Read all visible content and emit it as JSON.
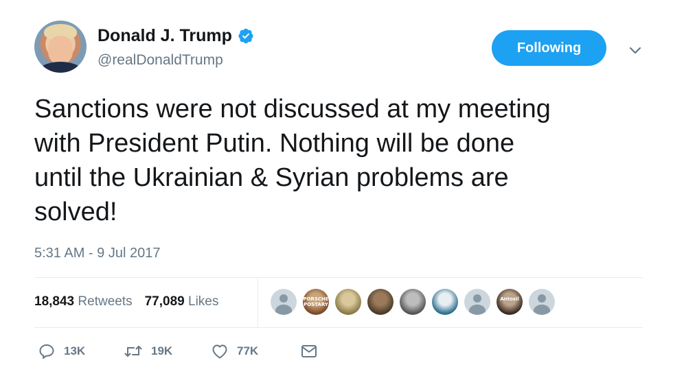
{
  "author": {
    "name": "Donald J. Trump",
    "handle": "@realDonaldTrump",
    "verified_icon": "verified-badge-icon"
  },
  "follow_button": {
    "label": "Following",
    "color": "#1da1f2"
  },
  "menu_icon": "chevron-down-icon",
  "tweet": {
    "line1": "Sanctions were not discussed at my meeting",
    "line2": "with President Putin. Nothing will be done",
    "line3": "until the Ukrainian & Syrian problems are",
    "line4": "solved!",
    "timestamp": "5:31 AM - 9 Jul 2017"
  },
  "stats": {
    "retweets_count": "18,843",
    "retweets_label": "Retweets",
    "likes_count": "77,089",
    "likes_label": "Likes"
  },
  "likers": [
    {
      "kind": "default"
    },
    {
      "kind": "image",
      "colors": [
        "#7b4a2a",
        "#c9a47a"
      ],
      "text": "PORSCHE POSTARY"
    },
    {
      "kind": "image",
      "colors": [
        "#8b7a4a",
        "#d8c89a"
      ]
    },
    {
      "kind": "image",
      "colors": [
        "#4a3a2a",
        "#9a7a5a"
      ]
    },
    {
      "kind": "image",
      "colors": [
        "#555555",
        "#bdbdbd"
      ]
    },
    {
      "kind": "image",
      "colors": [
        "#2e6e8e",
        "#e8eef2"
      ]
    },
    {
      "kind": "default"
    },
    {
      "kind": "image",
      "colors": [
        "#3a2a22",
        "#bca38a"
      ],
      "text": "Antosil"
    },
    {
      "kind": "default"
    }
  ],
  "actions": {
    "reply_count": "13K",
    "retweet_count": "19K",
    "like_count": "77K"
  },
  "colors": {
    "text_primary": "#14171a",
    "text_secondary": "#657786",
    "brand_blue": "#1da1f2",
    "divider": "#e6ecf0"
  }
}
